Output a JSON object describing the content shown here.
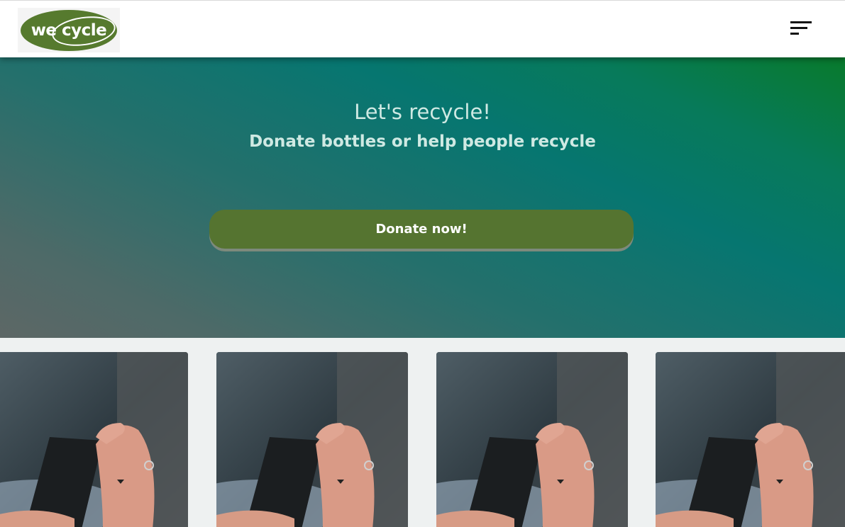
{
  "header": {
    "logo_text": "we cycle",
    "menu_icon": "hamburger-menu-icon"
  },
  "hero": {
    "title": "Let's recycle!",
    "subtitle": "Donate bottles or help people recycle",
    "cta_label": "Donate now!"
  },
  "colors": {
    "brand_green": "#557430",
    "hero_teal": "#067670",
    "hero_green": "#087a2c",
    "text_light": "#cfe9e3"
  },
  "cards": [
    {
      "image": "hand-holding-phone-photo"
    },
    {
      "image": "hand-holding-phone-photo"
    },
    {
      "image": "hand-holding-phone-photo"
    },
    {
      "image": "hand-holding-phone-photo"
    }
  ]
}
